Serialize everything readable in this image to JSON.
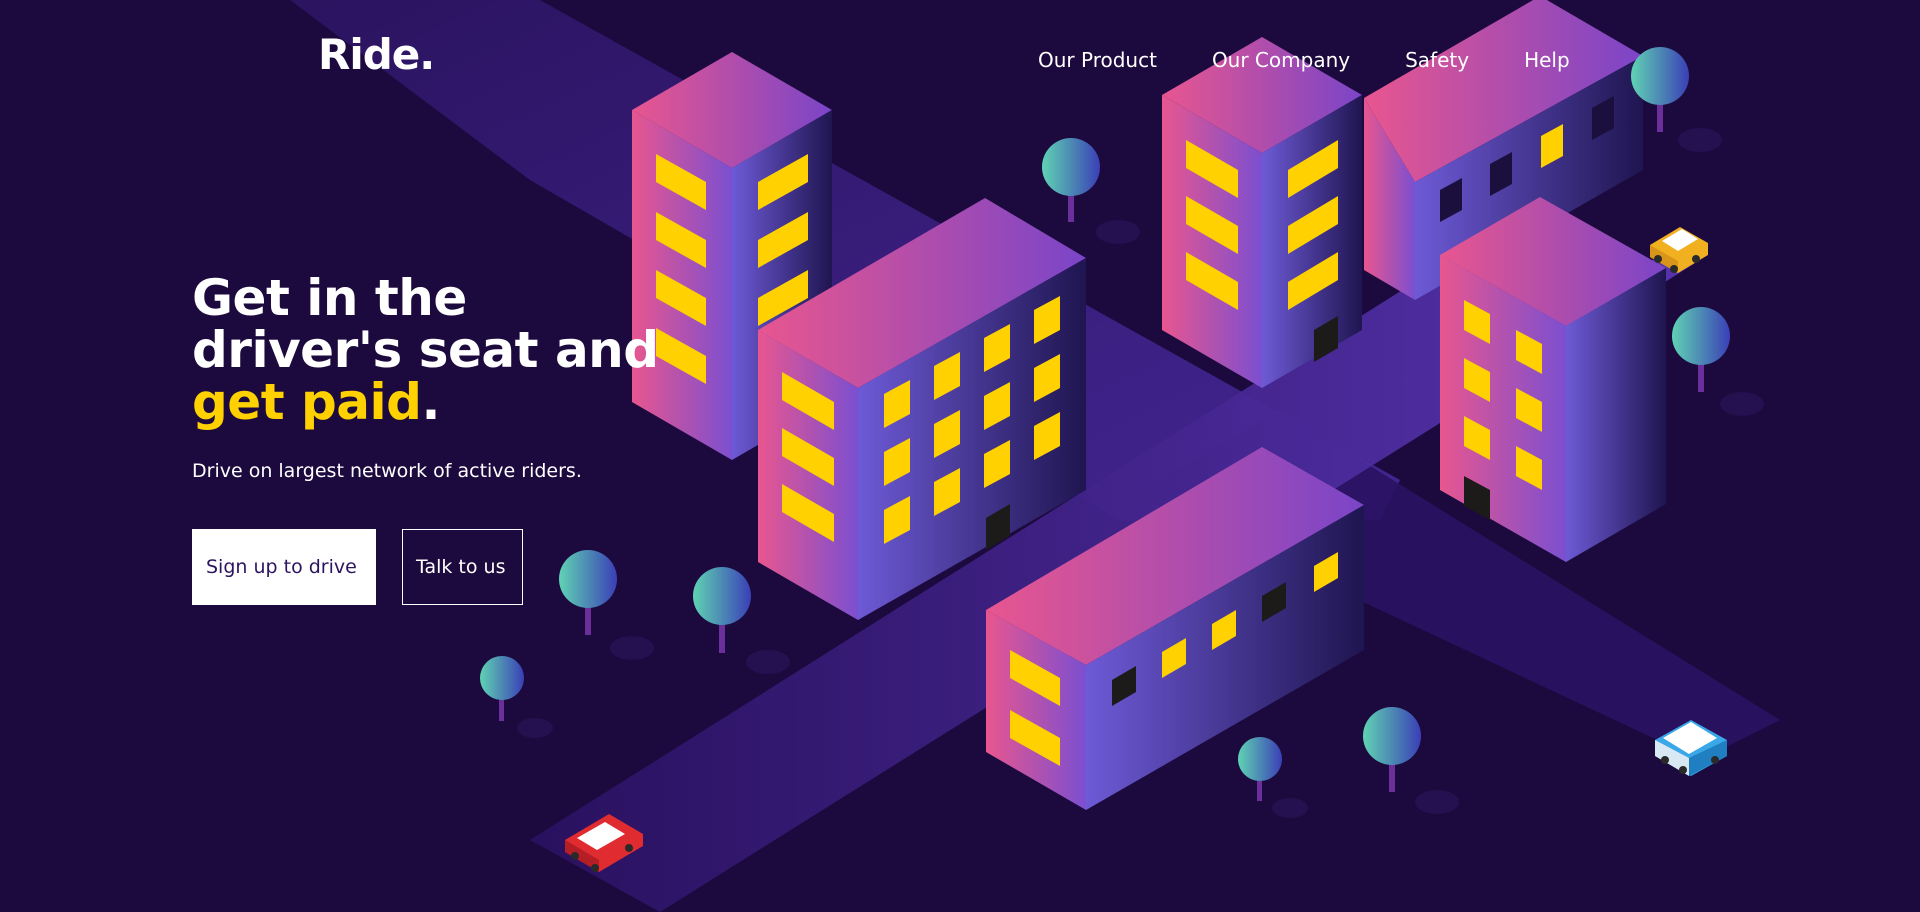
{
  "brand": {
    "logo": "Ride."
  },
  "nav": {
    "items": [
      {
        "label": "Our Product"
      },
      {
        "label": "Our Company"
      },
      {
        "label": "Safety"
      },
      {
        "label": "Help"
      }
    ]
  },
  "hero": {
    "title_line1": "Get in the",
    "title_line2": "driver's seat and",
    "title_highlight": "get paid",
    "title_period": ".",
    "subtitle": "Drive on largest network of active riders."
  },
  "actions": {
    "signup_label": "Sign up to drive",
    "talk_label": "Talk to us"
  },
  "colors": {
    "background": "#1c0a3e",
    "accent_yellow": "#ffd100",
    "building_pink": "#e8568f",
    "building_purple": "#6a4bc6",
    "road": "#3b1f80"
  },
  "illustration": {
    "icons": [
      "building-icon",
      "tree-icon",
      "car-icon",
      "van-icon"
    ]
  }
}
